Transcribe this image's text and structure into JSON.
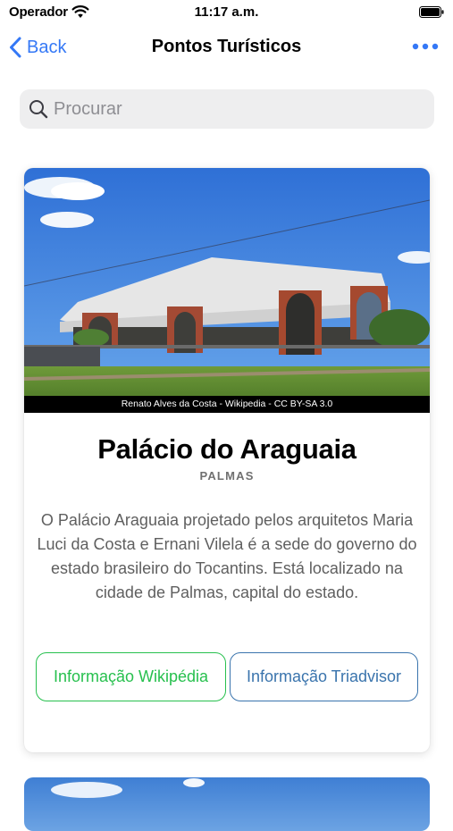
{
  "status_bar": {
    "carrier": "Operador",
    "time": "11:17 a.m."
  },
  "nav": {
    "back_label": "Back",
    "title": "Pontos Turísticos",
    "back_icon": "chevron-left-icon",
    "more_icon": "ellipsis-icon",
    "accent_color": "#3478f6"
  },
  "search": {
    "placeholder": "Procurar",
    "value": ""
  },
  "card": {
    "photo_caption": "Renato Alves da Costa - Wikipedia - CC BY-SA 3.0",
    "title": "Palácio do Araguaia",
    "city": "PALMAS",
    "description": "O Palácio Araguaia projetado pelos arquitetos Maria Luci da Costa e Ernani Vilela é a sede do governo do estado brasileiro do Tocantins. Está localizado na cidade de Palmas, capital do estado.",
    "buttons": {
      "wikipedia_label": "Informação Wikipédia",
      "wikipedia_color": "#27c04e",
      "tripadvisor_label": "Informação Triadvisor",
      "tripadvisor_color": "#3a74ad"
    }
  }
}
